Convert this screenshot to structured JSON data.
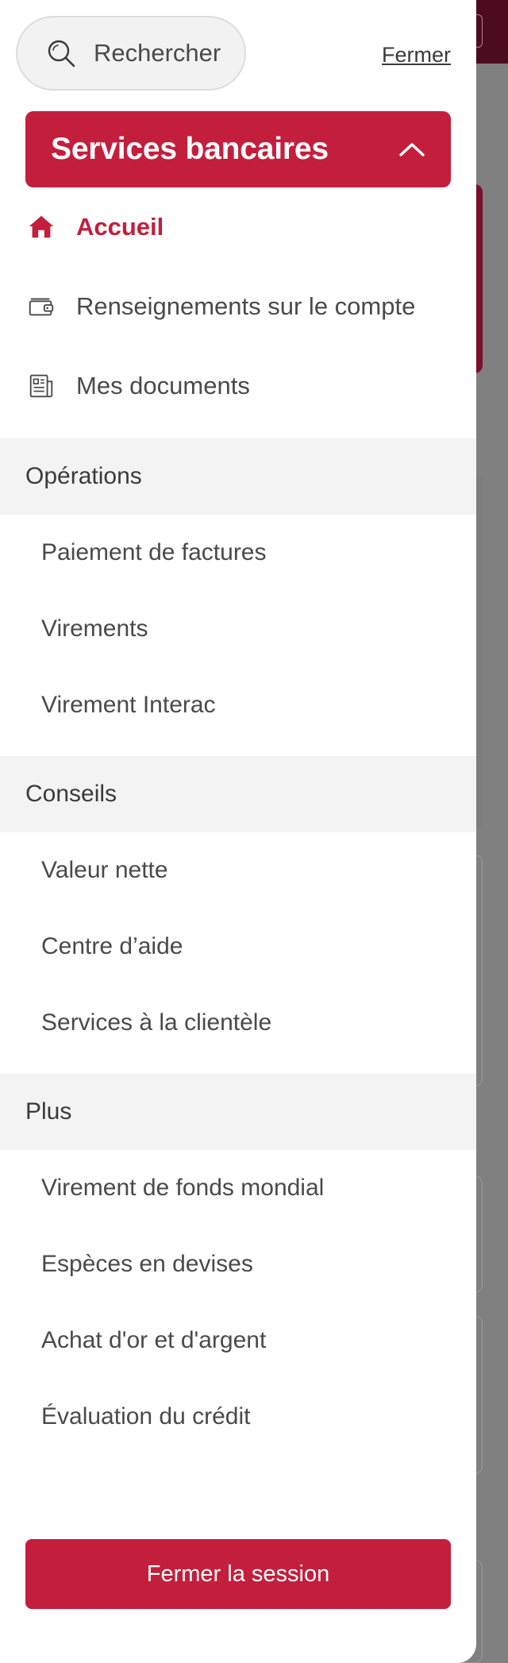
{
  "search": {
    "label": "Rechercher"
  },
  "header": {
    "close_label": "Fermer"
  },
  "section": {
    "title": "Services bancaires",
    "expanded": true
  },
  "primary_items": [
    {
      "label": "Accueil",
      "icon": "home-icon",
      "active": true
    },
    {
      "label": "Renseignements sur le compte",
      "icon": "wallet-icon",
      "active": false
    },
    {
      "label": "Mes documents",
      "icon": "document-icon",
      "active": false
    }
  ],
  "groups": [
    {
      "title": "Opérations",
      "items": [
        "Paiement de factures",
        "Virements",
        "Virement Interac"
      ]
    },
    {
      "title": "Conseils",
      "items": [
        "Valeur nette",
        "Centre d’aide",
        "Services à la clientèle"
      ]
    },
    {
      "title": "Plus",
      "items": [
        "Virement de fonds mondial",
        "Espèces en devises",
        "Achat d'or et d'argent",
        "Évaluation du crédit"
      ]
    }
  ],
  "footer": {
    "logout_label": "Fermer la session"
  },
  "colors": {
    "brand": "#c41e3d",
    "group_bg": "#f3f3f4",
    "text": "#4a4a4a",
    "backdrop": "#808080",
    "topbar": "#4d0c1e"
  }
}
